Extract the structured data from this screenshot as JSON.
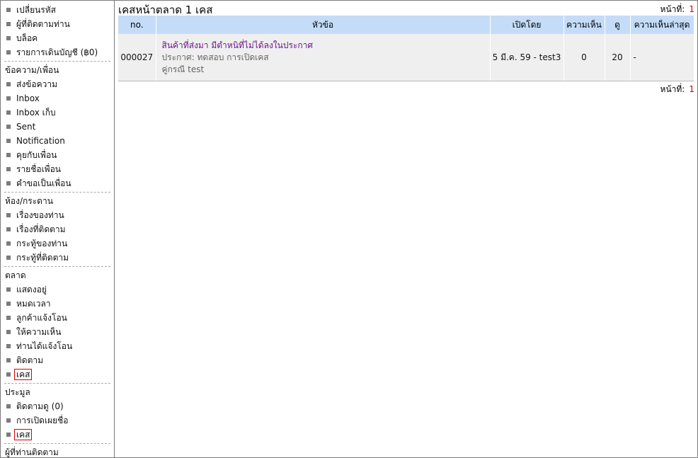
{
  "sidebar": {
    "sections": [
      {
        "header": "",
        "items": [
          {
            "label": "เปลี่ยนรหัส",
            "selected": false
          },
          {
            "label": "ผู้ที่ติดตามท่าน",
            "selected": false
          },
          {
            "label": "บล็อค",
            "selected": false
          },
          {
            "label": "รายการเดินบัญชี (฿0)",
            "selected": false
          }
        ]
      },
      {
        "header": "ข้อความ/เพื่อน",
        "items": [
          {
            "label": "ส่งข้อความ",
            "selected": false
          },
          {
            "label": "Inbox",
            "selected": false
          },
          {
            "label": "Inbox เก็บ",
            "selected": false
          },
          {
            "label": "Sent",
            "selected": false
          },
          {
            "label": "Notification",
            "selected": false
          },
          {
            "label": "คุยกับเพื่อน",
            "selected": false
          },
          {
            "label": "รายชื่อเพื่อน",
            "selected": false
          },
          {
            "label": "คำขอเป็นเพื่อน",
            "selected": false
          }
        ]
      },
      {
        "header": "ห้อง/กระดาน",
        "items": [
          {
            "label": "เรื่องของท่าน",
            "selected": false
          },
          {
            "label": "เรื่องที่ติดตาม",
            "selected": false
          },
          {
            "label": "กระทู้ของท่าน",
            "selected": false
          },
          {
            "label": "กระทู้ที่ติดตาม",
            "selected": false
          }
        ]
      },
      {
        "header": "ตลาด",
        "items": [
          {
            "label": "แสดงอยู่",
            "selected": false
          },
          {
            "label": "หมดเวลา",
            "selected": false
          },
          {
            "label": "ลูกค้าแจ้งโอน",
            "selected": false
          },
          {
            "label": "ให้ความเห็น",
            "selected": false
          },
          {
            "label": "ท่านได้แจ้งโอน",
            "selected": false
          },
          {
            "label": "ติดตาม",
            "selected": false
          },
          {
            "label": "เคส",
            "selected": true
          }
        ]
      },
      {
        "header": "ประมูล",
        "items": [
          {
            "label": "ติดตามดู (0)",
            "selected": false
          },
          {
            "label": "การเปิดเผยชื่อ",
            "selected": false
          },
          {
            "label": "เคส",
            "selected": true
          }
        ]
      },
      {
        "header": "ผู้ที่ท่านติดตาม",
        "items": []
      }
    ]
  },
  "main": {
    "title": "เคสหน้าตลาด 1 เคส",
    "pager_label": "หน้าที่:",
    "current_page": "1",
    "columns": {
      "no": "no.",
      "topic": "หัวข้อ",
      "opened_by": "เปิดโดย",
      "comments": "ความเห็น",
      "views": "ดู",
      "last_comment": "ความเห็นล่าสุด"
    },
    "rows": [
      {
        "no": "000027",
        "topic": "สินค้าที่ส่งมา มีตำหนิที่ไม่ได้ลงในประกาศ",
        "announcement": "ประกาศ: ทดสอบ การเปิดเคส",
        "party": "คู่กรณี test",
        "opened_by": "5 มี.ค. 59 - test3",
        "comments": "0",
        "views": "20",
        "last_comment": "-"
      }
    ]
  },
  "colors": {
    "header_bg": "#c5dcf8",
    "row_bg": "#efefef",
    "link": "#6b168a",
    "page_number": "#d40000",
    "selection_border": "#d40000"
  }
}
